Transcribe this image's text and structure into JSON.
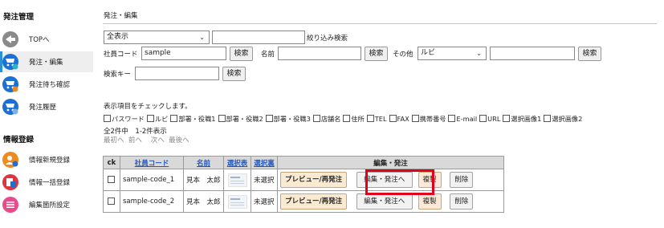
{
  "sidebar": {
    "section1": "発注管理",
    "section2": "情報登録",
    "items": [
      {
        "label": "TOPへ",
        "icon": "back-arrow-icon"
      },
      {
        "label": "発注・編集",
        "icon": "order-edit-icon"
      },
      {
        "label": "発注待ち確認",
        "icon": "order-waiting-icon"
      },
      {
        "label": "発注履歴",
        "icon": "order-history-icon"
      },
      {
        "label": "情報新規登録",
        "icon": "new-registration-icon"
      },
      {
        "label": "情報一括登録",
        "icon": "bulk-registration-icon"
      },
      {
        "label": "編集箇所設定",
        "icon": "edit-settings-icon"
      }
    ]
  },
  "breadcrumb": "発注・編集",
  "filter": {
    "display_select": "全表示",
    "narrow_search": "絞り込み検索",
    "emp_code_label": "社員コード",
    "emp_code_value": "sample",
    "search": "検索",
    "name_label": "名前",
    "name_value": "",
    "other_label": "その他",
    "other_select": "ルビ",
    "other_value": "",
    "key_label": "検索キー",
    "key_value": ""
  },
  "columns_prompt": "表示項目をチェックします。",
  "column_options": [
    "パスワード",
    "ルビ",
    "部署・役職1",
    "部署・役職2",
    "部署・役職3",
    "店舗名",
    "住所",
    "TEL",
    "FAX",
    "携帯番号",
    "E-mail",
    "URL",
    "選択画像1",
    "選択画像2"
  ],
  "pagination": {
    "total": "全2件中　1-2件表示",
    "first": "最初へ",
    "prev": "前へ",
    "next": "次へ",
    "last": "最後へ"
  },
  "table": {
    "headers": {
      "ck": "ck",
      "code": "社員コード",
      "name": "名前",
      "sel1": "選択表",
      "sel2": "選択裏",
      "actions": "編集・発注"
    },
    "rows": [
      {
        "code": "sample-code_1",
        "name": "見本　太郎",
        "status": "未選択"
      },
      {
        "code": "sample-code_2",
        "name": "見本　太郎",
        "status": "未選択"
      }
    ],
    "buttons": {
      "preview": "プレビュー/再発注",
      "edit": "編集・発注へ",
      "copy": "複製",
      "delete": "削除"
    }
  },
  "colors": {
    "accent": "#2a8fd9",
    "highlight": "#e3001b",
    "icon_blue": "#1d6fd2",
    "icon_orange": "#f08a1c",
    "icon_red": "#e2343f",
    "icon_pink": "#e84a8a",
    "link": "#1f58c4"
  }
}
